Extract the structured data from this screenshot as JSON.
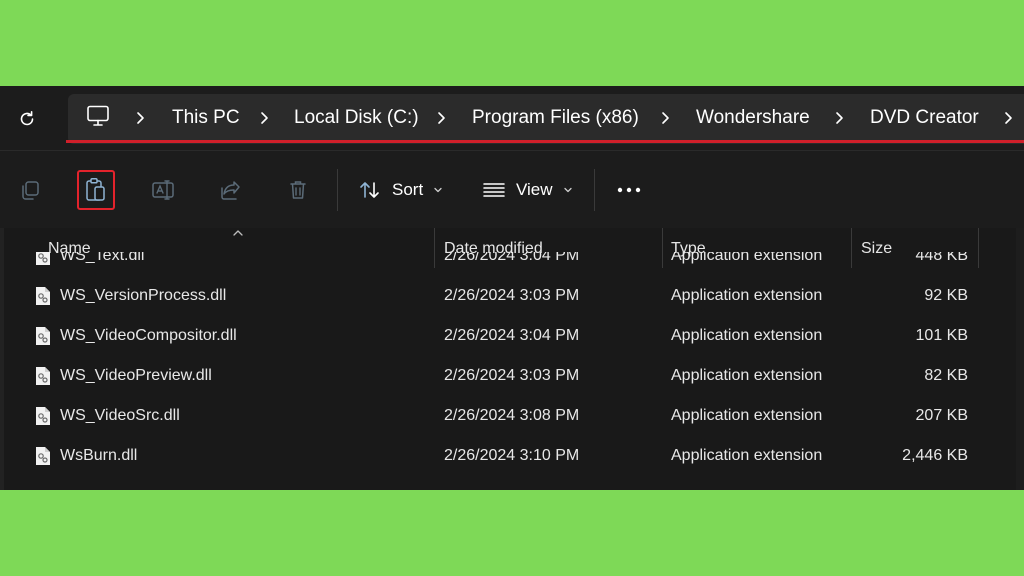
{
  "address_bar": {
    "crumbs": [
      "This PC",
      "Local Disk (C:)",
      "Program Files (x86)",
      "Wondershare",
      "DVD Creator"
    ]
  },
  "toolbar": {
    "sort_label": "Sort",
    "view_label": "View"
  },
  "columns": [
    "Name",
    "Date modified",
    "Type",
    "Size"
  ],
  "files": [
    {
      "name": "WS_Text.dll",
      "date": "2/26/2024 3:04 PM",
      "type": "Application extension",
      "size": "448 KB"
    },
    {
      "name": "WS_VersionProcess.dll",
      "date": "2/26/2024 3:03 PM",
      "type": "Application extension",
      "size": "92 KB"
    },
    {
      "name": "WS_VideoCompositor.dll",
      "date": "2/26/2024 3:04 PM",
      "type": "Application extension",
      "size": "101 KB"
    },
    {
      "name": "WS_VideoPreview.dll",
      "date": "2/26/2024 3:03 PM",
      "type": "Application extension",
      "size": "82 KB"
    },
    {
      "name": "WS_VideoSrc.dll",
      "date": "2/26/2024 3:08 PM",
      "type": "Application extension",
      "size": "207 KB"
    },
    {
      "name": "WsBurn.dll",
      "date": "2/26/2024 3:10 PM",
      "type": "Application extension",
      "size": "2,446 KB"
    }
  ],
  "colors": {
    "background": "#7ed957",
    "window": "#191919",
    "highlight": "#e3232c"
  },
  "icons": [
    "refresh-icon",
    "this-pc-icon",
    "chevron-right-icon",
    "copy-icon",
    "paste-icon",
    "rename-icon",
    "share-icon",
    "delete-icon",
    "sort-icon",
    "view-icon",
    "more-icon",
    "dll-file-icon"
  ]
}
